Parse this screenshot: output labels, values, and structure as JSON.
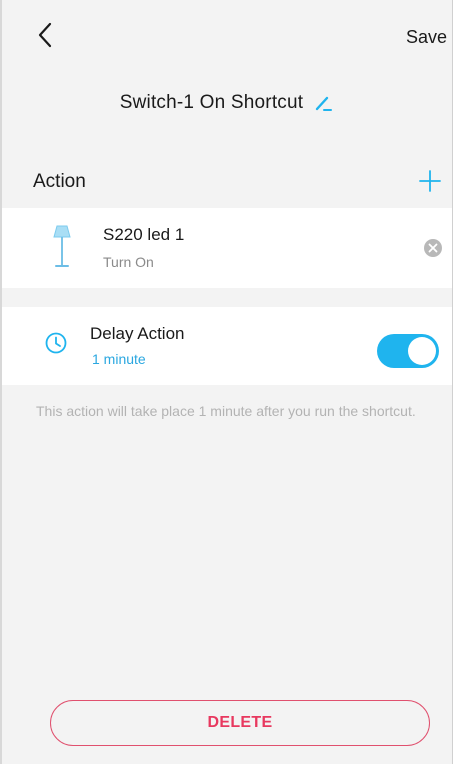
{
  "header": {
    "back_icon": "chevron-left-icon",
    "save_label": "Save",
    "title": "Switch-1 On Shortcut",
    "edit_icon": "pencil-icon"
  },
  "actions": {
    "section_label": "Action",
    "add_icon": "plus-icon",
    "device": {
      "icon": "floor-lamp-icon",
      "name": "S220 led 1",
      "state": "Turn On",
      "remove_icon": "clear-icon"
    },
    "delay": {
      "icon": "clock-icon",
      "title": "Delay Action",
      "value": "1 minute",
      "enabled": true
    },
    "note": "This action will take place 1 minute after you run the shortcut."
  },
  "footer": {
    "delete_label": "DELETE"
  },
  "colors": {
    "accent": "#1fb4ee",
    "link": "#2aa7e0",
    "danger": "#e8385f",
    "background": "#f3f3f3",
    "card": "#ffffff"
  }
}
